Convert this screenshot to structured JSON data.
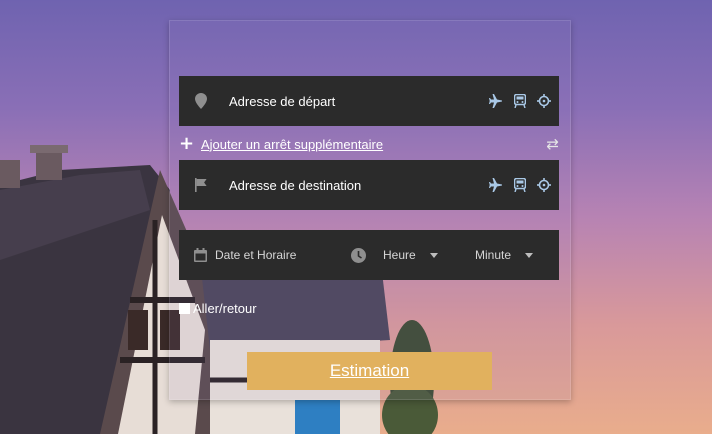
{
  "form": {
    "departure": {
      "label": "Adresse de départ",
      "icons": [
        "pin-icon",
        "plane-icon",
        "train-icon",
        "crosshair-icon"
      ]
    },
    "add_stop": {
      "label": "Ajouter un arrêt supplémentaire",
      "icon": "plus-icon",
      "swap_icon": "swap-icon"
    },
    "destination": {
      "label": "Adresse de destination",
      "icons": [
        "flag-icon",
        "plane-icon",
        "train-icon",
        "crosshair-icon"
      ]
    },
    "datetime": {
      "label": "Date et Horaire",
      "hour_label": "Heure",
      "minute_label": "Minute"
    },
    "roundtrip_label": "Aller/retour",
    "estimate_label": "Estimation"
  },
  "colors": {
    "field_bg": "#2b2b2b",
    "button_bg": "#e1b15e",
    "icon_color": "#a9c8e6"
  }
}
